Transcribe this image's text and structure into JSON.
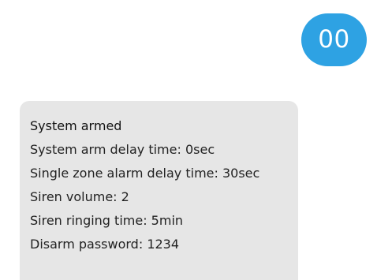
{
  "sent_message": {
    "text": "00",
    "color": "#2ea2e3"
  },
  "received_message": {
    "background": "#e6e6e6",
    "lines": [
      "System armed",
      "System arm delay time: 0sec",
      "Single zone alarm delay time: 30sec",
      "Siren volume: 2",
      "Siren ringing time: 5min",
      "Disarm password: 1234"
    ]
  }
}
